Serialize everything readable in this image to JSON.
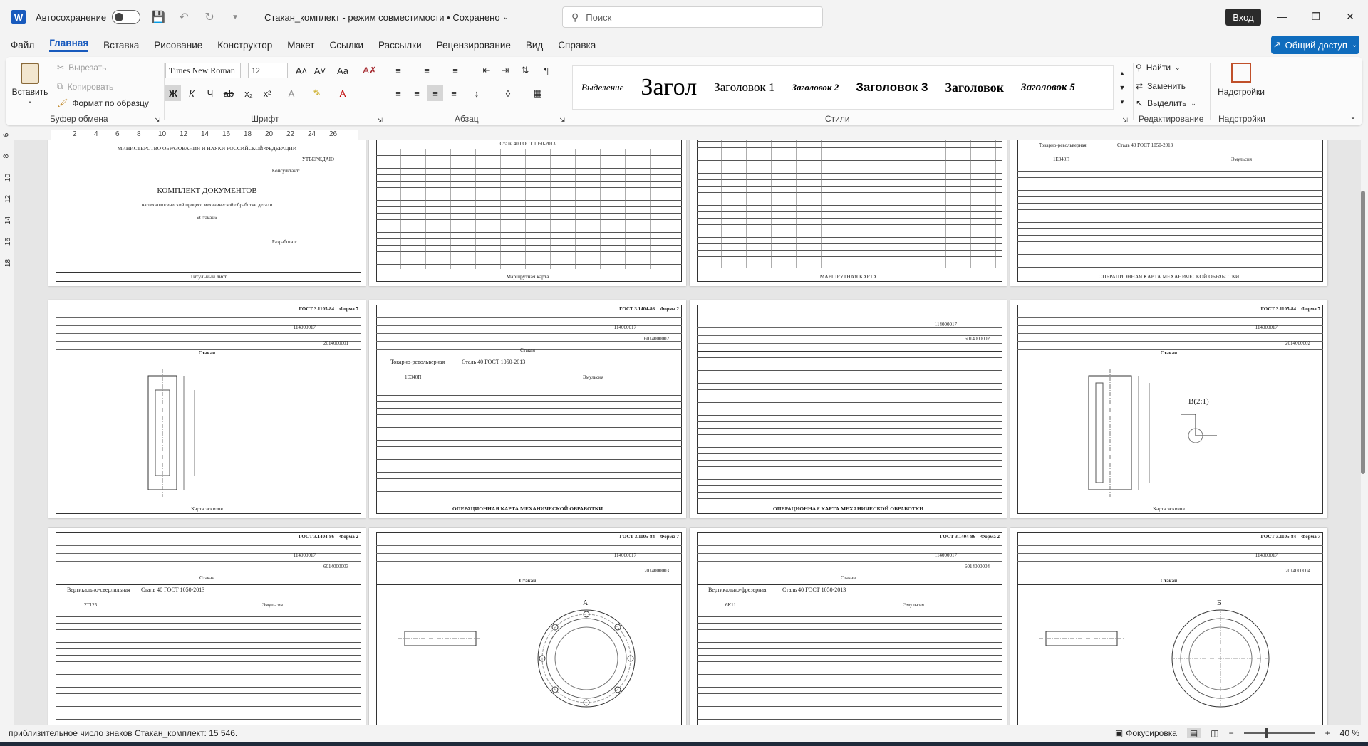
{
  "titlebar": {
    "app_letter": "W",
    "autosave_label": "Автосохранение",
    "doc_title": "Стакан_комплект - режим совместимости • Сохранено",
    "search_placeholder": "Поиск",
    "login_label": "Вход"
  },
  "tabs": [
    "Файл",
    "Главная",
    "Вставка",
    "Рисование",
    "Конструктор",
    "Макет",
    "Ссылки",
    "Рассылки",
    "Рецензирование",
    "Вид",
    "Справка"
  ],
  "share_label": "Общий доступ",
  "ribbon": {
    "paste": "Вставить",
    "cut": "Вырезать",
    "copy": "Копировать",
    "format_painter": "Формат по образцу",
    "clipboard_group": "Буфер обмена",
    "font_name": "Times New Roman",
    "font_size": "12",
    "font_group": "Шрифт",
    "paragraph_group": "Абзац",
    "styles": [
      "Выделение",
      "Загол",
      "Заголовок 1",
      "Заголовок 2",
      "Заголовок 3",
      "Заголовок",
      "Заголовок 5"
    ],
    "styles_group": "Стили",
    "find": "Найти",
    "replace": "Заменить",
    "select": "Выделить",
    "editing_group": "Редактирование",
    "addins": "Надстройки",
    "addins_group": "Надстройки",
    "bold": "Ж",
    "italic": "К",
    "underline": "Ч"
  },
  "ruler": {
    "h_ticks": [
      "2",
      "4",
      "6",
      "8",
      "10",
      "12",
      "14",
      "16",
      "18",
      "20",
      "22",
      "24",
      "26"
    ],
    "v_ticks": [
      "6",
      "8",
      "10",
      "12",
      "14",
      "16",
      "18"
    ]
  },
  "pages": {
    "title_page": {
      "ministry": "МИНИСТЕРСТВО ОБРАЗОВАНИЯ И НАУКИ РОССИЙСКОЙ ФЕДЕРАЦИИ",
      "approve": "УТВЕРЖДАЮ",
      "consultant": "Консультант:",
      "heading": "КОМПЛЕКТ ДОКУМЕНТОВ",
      "subheading": "на технологический процесс механической обработки детали",
      "part": "«Стакан»",
      "developed": "Разработал:",
      "caption": "Титульный лист"
    },
    "route_card_1": {
      "material": "Сталь 40 ГОСТ 1050-2013",
      "caption": "Маршрутная карта"
    },
    "route_card_2": {
      "caption": "МАРШРУТНАЯ КАРТА"
    },
    "op_card_1": {
      "machine": "Токарно-револьверная",
      "material": "Сталь 40 ГОСТ 1050-2013",
      "model": "1Е340П",
      "fluid": "Эмульсия",
      "caption": "ОПЕРАЦИОННАЯ КАРТА МЕХАНИЧЕСКОЙ ОБРАБОТКИ"
    },
    "sketch_1": {
      "gost": "ГОСТ 3.1105-84",
      "form": "Форма 7",
      "code": "114000017",
      "doc": "2014000001",
      "part": "Стакан",
      "caption": "Карта эскизов"
    },
    "op_card_2": {
      "gost": "ГОСТ 3.1404-86",
      "form": "Форма 2",
      "code": "114000017",
      "doc": "6014000002",
      "part": "Стакан",
      "machine": "Токарно-револьверная",
      "material": "Сталь 40 ГОСТ 1050-2013",
      "model": "1Е340П",
      "fluid": "Эмульсия",
      "caption": "ОПЕРАЦИОННАЯ КАРТА МЕХАНИЧЕСКОЙ ОБРАБОТКИ"
    },
    "op_card_3": {
      "code": "114000017",
      "doc": "6014000002",
      "caption": "ОПЕРАЦИОННАЯ КАРТА МЕХАНИЧЕСКОЙ ОБРАБОТКИ"
    },
    "sketch_2": {
      "gost": "ГОСТ 3.1105-84",
      "form": "Форма 7",
      "code": "114000017",
      "doc": "2014000002",
      "part": "Стакан",
      "view": "В(2:1)",
      "caption": "Карта эскизов"
    },
    "op_card_4": {
      "gost": "ГОСТ 3.1404-86",
      "form": "Форма 2",
      "code": "114000017",
      "doc": "6014000003",
      "part": "Стакан",
      "machine": "Вертикально-сверлильная",
      "material": "Сталь 40 ГОСТ 1050-2013",
      "model": "2Т125",
      "fluid": "Эмульсия"
    },
    "sketch_3": {
      "gost": "ГОСТ 3.1105-84",
      "form": "Форма 7",
      "code": "114000017",
      "doc": "2014000003",
      "part": "Стакан",
      "view": "А"
    },
    "op_card_5": {
      "gost": "ГОСТ 3.1404-86",
      "form": "Форма 2",
      "code": "114000017",
      "doc": "6014000004",
      "part": "Стакан",
      "machine": "Вертикально-фрезерная",
      "material": "Сталь 40 ГОСТ 1050-2013",
      "model": "6К11",
      "fluid": "Эмульсия"
    },
    "sketch_4": {
      "gost": "ГОСТ 3.1105-84",
      "form": "Форма 7",
      "code": "114000017",
      "doc": "2014000004",
      "part": "Стакан",
      "view": "Б"
    }
  },
  "status": {
    "word_count": "приблизительное число знаков Стакан_комплект: 15 546.",
    "focus": "Фокусировка",
    "zoom": "40 %"
  }
}
